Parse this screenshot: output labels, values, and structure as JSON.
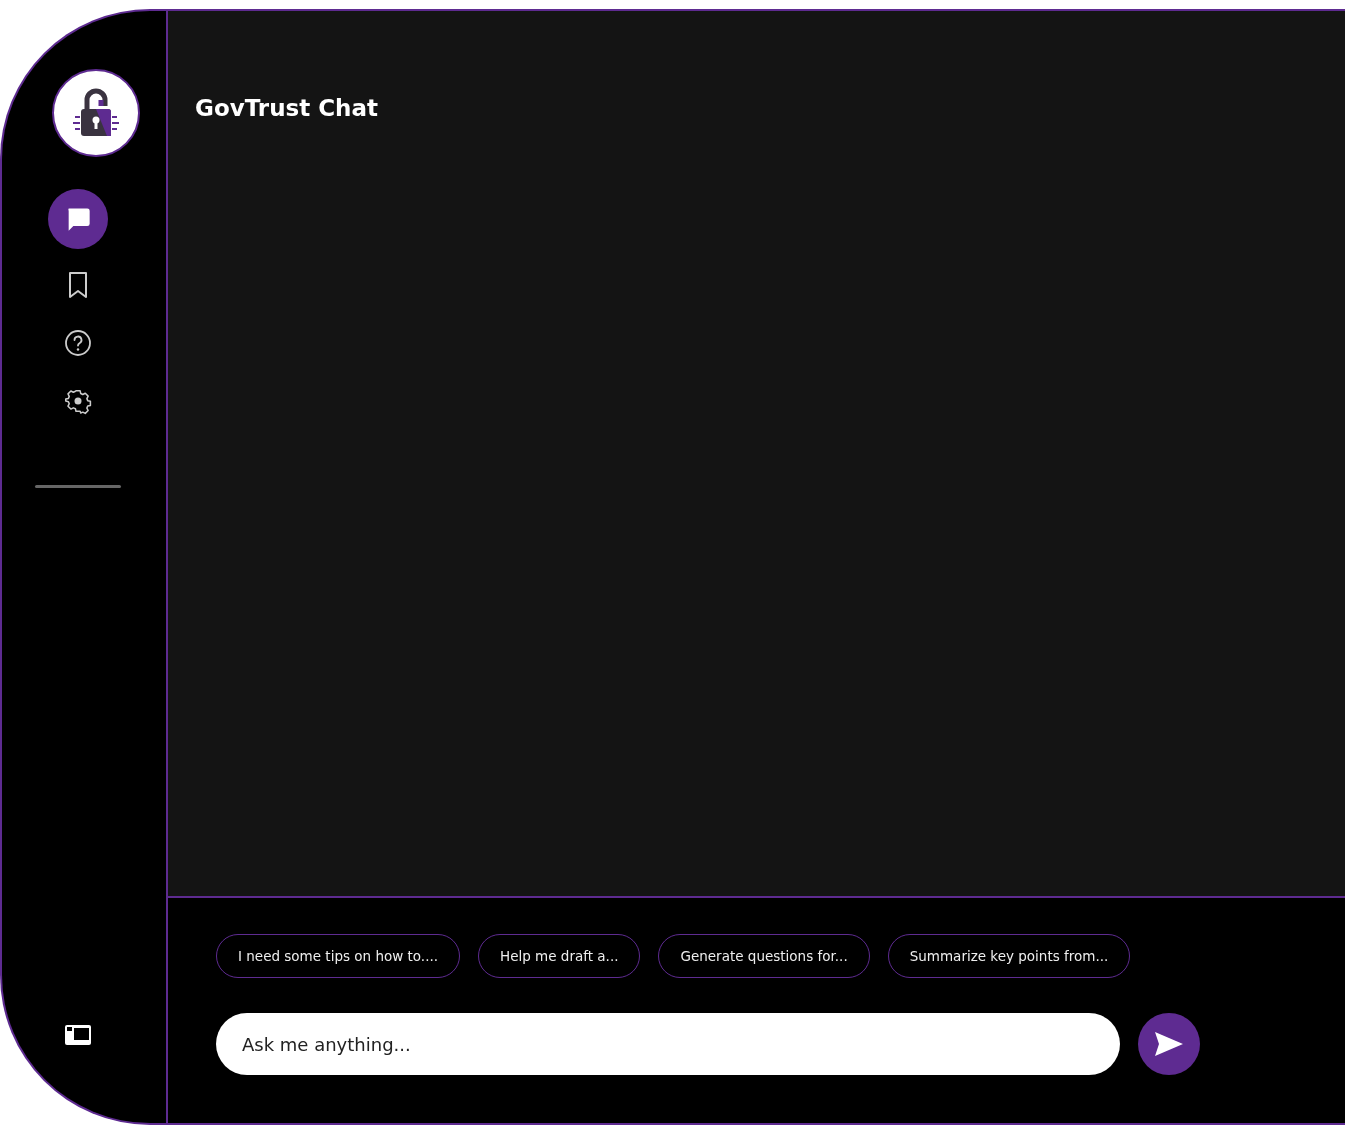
{
  "sidebar": {
    "items": [
      {
        "kind": "chat",
        "selected": true
      },
      {
        "kind": "bookmark",
        "selected": false
      },
      {
        "kind": "help",
        "selected": false
      },
      {
        "kind": "settings",
        "selected": false
      }
    ]
  },
  "header": {
    "title": "GovTrust Chat"
  },
  "suggestions": [
    "I need some tips on how to....",
    "Help me draft a...",
    "Generate questions for...",
    "Summarize key points from..."
  ],
  "composer": {
    "placeholder": "Ask me anything..."
  }
}
